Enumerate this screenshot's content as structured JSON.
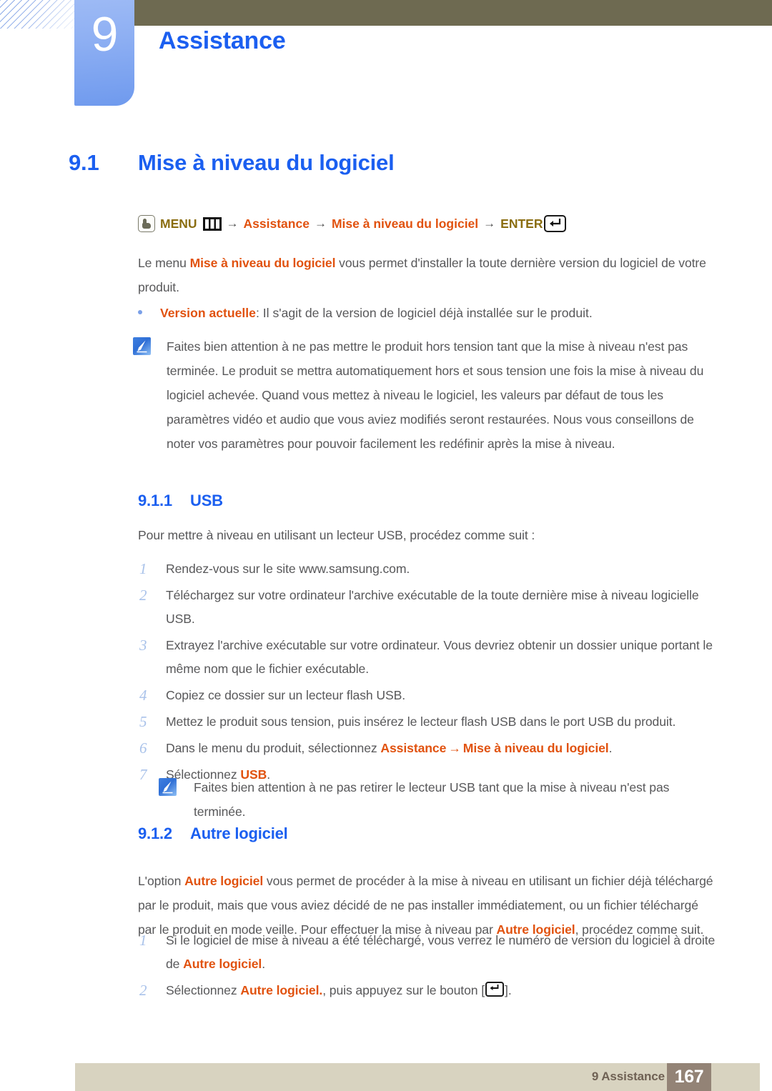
{
  "header": {
    "chapter_number": "9",
    "chapter_title": "Assistance",
    "accent_blue": "#1b5ff0",
    "tab_blue": "#8fb0f3",
    "olive": "#6e6a51"
  },
  "section": {
    "number": "9.1",
    "title": "Mise à niveau du logiciel"
  },
  "breadcrumb": {
    "hand_icon": "hand-press-icon",
    "menu_label": "MENU",
    "bars_icon": "menu-bars-icon",
    "arrow": "→",
    "step_1": "Assistance",
    "step_2": "Mise à niveau du logiciel",
    "enter_label": "ENTER",
    "enter_icon": "enter-key-icon",
    "gold": "#8a6d10",
    "orange": "#e1520f"
  },
  "intro": {
    "part_1": "Le menu ",
    "highlight": "Mise à niveau du logiciel",
    "part_2": " vous permet d'installer la toute dernière version du logiciel de votre produit."
  },
  "bullet": {
    "term": "Version actuelle",
    "rest": ": Il s'agit de la version de logiciel déjà installée sur le produit."
  },
  "note_1": {
    "icon": "note-pen-icon",
    "text": "Faites bien attention à ne pas mettre le produit hors tension tant que la mise à niveau n'est pas terminée. Le produit se mettra automatiquement hors et sous tension une fois la mise à niveau du logiciel achevée. Quand vous mettez à niveau le logiciel, les valeurs par défaut de tous les paramètres vidéo et audio que vous aviez modifiés seront restaurées. Nous vous conseillons de noter vos paramètres pour pouvoir facilement les redéfinir après la mise à niveau."
  },
  "subsection_usb": {
    "number": "9.1.1",
    "title": "USB",
    "intro": "Pour mettre à niveau en utilisant un lecteur USB, procédez comme suit :",
    "steps": [
      {
        "n": "1",
        "text": "Rendez-vous sur le site www.samsung.com."
      },
      {
        "n": "2",
        "text": "Téléchargez sur votre ordinateur l'archive exécutable de la toute dernière mise à niveau logicielle USB."
      },
      {
        "n": "3",
        "text": "Extrayez l'archive exécutable sur votre ordinateur. Vous devriez obtenir un dossier unique portant le même nom que le fichier exécutable."
      },
      {
        "n": "4",
        "text": "Copiez ce dossier sur un lecteur flash USB."
      },
      {
        "n": "5",
        "text": "Mettez le produit sous tension, puis insérez le lecteur flash USB dans le port USB du produit."
      },
      {
        "n": "6",
        "text_pre": "Dans le menu du produit, sélectionnez ",
        "hl_1": "Assistance",
        "arrow": "→",
        "hl_2": "Mise à niveau du logiciel",
        "text_post": "."
      },
      {
        "n": "7",
        "text_pre": "Sélectionnez ",
        "hl_1": "USB",
        "text_post": "."
      }
    ]
  },
  "note_2": {
    "icon": "note-pen-icon",
    "text": "Faites bien attention à ne pas retirer le lecteur USB tant que la mise à niveau n'est pas terminée."
  },
  "subsection_autre": {
    "number": "9.1.2",
    "title": "Autre logiciel",
    "para": {
      "part_1": "L'option ",
      "hl_1": "Autre logiciel",
      "part_2": " vous permet de procéder à la mise à niveau en utilisant un fichier déjà téléchargé par le produit, mais que vous aviez décidé de ne pas installer immédiatement, ou un fichier téléchargé par le produit en mode veille. Pour effectuer la mise à niveau par ",
      "hl_2": "Autre logiciel",
      "part_3": ", procédez comme suit."
    },
    "steps": [
      {
        "n": "1",
        "text_pre": "Si le logiciel de mise à niveau a été téléchargé, vous verrez le numéro de version du logiciel à droite de ",
        "hl_1": "Autre logiciel",
        "text_post": "."
      },
      {
        "n": "2",
        "text_pre": "Sélectionnez ",
        "hl_1": "Autre logiciel.",
        "text_mid": ", puis appuyez sur le bouton [",
        "icon": "enter-key-icon",
        "text_post": "]."
      }
    ]
  },
  "footer": {
    "label": "9 Assistance",
    "page_number": "167",
    "bar_color": "#d8d3c0",
    "box_color": "#938376"
  }
}
